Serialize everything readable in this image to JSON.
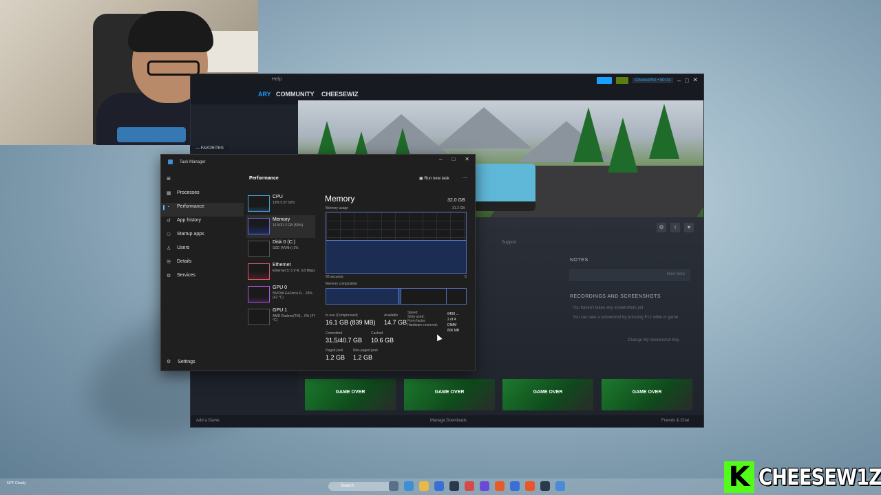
{
  "steam": {
    "menu": "Help",
    "nav": [
      "ARY",
      "COMMUNITY",
      "CHEESEWIZ"
    ],
    "user": "CheeseWiz • $0.01",
    "favorites": "— FAVORITES",
    "support": "Support",
    "notes_title": "NOTES",
    "new_note": "New Note",
    "recordings_title": "RECORDINGS AND SCREENSHOTS",
    "rec_text1": "You haven't taken any screenshots yet",
    "rec_text2": "You can take a screenshot by pressing F12 while in game.",
    "rec_link": "Change My Screenshot Key",
    "screenshots": [
      "GAME OVER",
      "GAME OVER",
      "GAME OVER",
      "GAME OVER"
    ],
    "footer_add": "Add a Game",
    "footer_downloads": "Manage Downloads",
    "footer_friends": "Friends & Chat"
  },
  "taskmanager": {
    "title": "Task Manager",
    "nav": [
      {
        "label": "Processes",
        "icon": "processes-icon",
        "glyph": "▦"
      },
      {
        "label": "Performance",
        "icon": "performance-icon",
        "glyph": "◔"
      },
      {
        "label": "App history",
        "icon": "app-history-icon",
        "glyph": "↺"
      },
      {
        "label": "Startup apps",
        "icon": "startup-icon",
        "glyph": "⚇"
      },
      {
        "label": "Users",
        "icon": "users-icon",
        "glyph": "♙"
      },
      {
        "label": "Details",
        "icon": "details-icon",
        "glyph": "☰"
      },
      {
        "label": "Services",
        "icon": "services-icon",
        "glyph": "⚙"
      }
    ],
    "settings": "Settings",
    "section": "Performance",
    "run_new_task": "Run new task",
    "resources": [
      {
        "name": "CPU",
        "sub": "13% 5.07 GHz",
        "kind": "cpu"
      },
      {
        "name": "Memory",
        "sub": "16.5/31.2 GB (53%)",
        "kind": "mem"
      },
      {
        "name": "Disk 0 (C:)",
        "sub": "SSD (NVMe) 1%",
        "kind": "disk"
      },
      {
        "name": "Ethernet",
        "sub": "Ethernet S: 5.9 R: 3.8 Mbps",
        "kind": "eth"
      },
      {
        "name": "GPU 0",
        "sub": "NVIDIA GeForce R... 26% (42 °C)",
        "kind": "gpu"
      },
      {
        "name": "GPU 1",
        "sub": "AMD Radeon(TM)... 0% (47 °C)",
        "kind": "disk"
      }
    ],
    "memory": {
      "heading": "Memory",
      "total": "32.0 GB",
      "usage_label": "Memory usage",
      "usage_max": "31.2 GB",
      "usage_fraction": 0.53,
      "axis_left": "60 seconds",
      "axis_right": "0",
      "composition_label": "Memory composition",
      "in_use_label": "In use (Compressed)",
      "in_use_value": "16.1 GB (839 MB)",
      "available_label": "Available",
      "available_value": "14.7 GB",
      "committed_label": "Committed",
      "committed_value": "31.5/40.7 GB",
      "cached_label": "Cached",
      "cached_value": "10.6 GB",
      "paged_label": "Paged pool",
      "paged_value": "1.2 GB",
      "nonpaged_label": "Non-paged pool",
      "nonpaged_value": "1.2 GB",
      "speed_label": "Speed:",
      "speed_value": "6400 ...",
      "slots_label": "Slots used:",
      "slots_value": "2 of 4",
      "form_label": "Form factor:",
      "form_value": "DIMM",
      "hw_label": "Hardware reserved:",
      "hw_value": "806 MB"
    }
  },
  "taskbar": {
    "search": "Search",
    "weather": "52°F Cloudy"
  },
  "brand": {
    "letter": "K",
    "name": "CHEESEW1Z"
  }
}
